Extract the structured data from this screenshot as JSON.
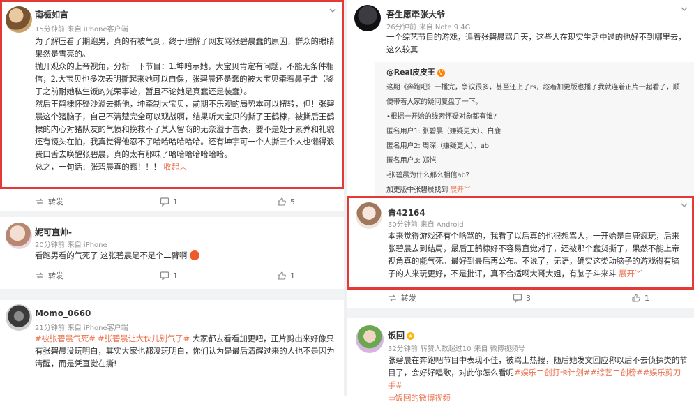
{
  "left": {
    "posts": [
      {
        "name": "南栀如言",
        "time": "15分钟前",
        "source": "来自 iPhone客户端",
        "paragraphs": [
          "为了解压看了期跑男，真的有被气到，终于理解了网友骂张碧晨蠢的原因，群众的眼睛果然是雪亮的。",
          "抛开观众的上帝视角，分析一下节目：1.坤暗示她，大宝贝肯定有问题，不能无条件相信；2.大宝贝也多次表明撕起来她可以自保，张碧晨还是蠢的被大宝贝牵着鼻子走（鉴于之前耐她私生饭的光荣事迹，暂且不论她是真蠢还是装蠢）。",
          "然后王鹤棣怀疑沙溢去撕他，坤牵制大宝贝，前期不乐观的局势本可以扭转，但！张碧晨这个猪脑子，自己不清楚完全可以观战啊，结果听大宝贝的撕了王鹤棣，被撕后王鹤棣的内心对猪队友的气愤和挽救不了某人智商的无奈溢于言表，要不是处于素养和礼貌还有镜头在拍，我真觉得他忍不了哈哈哈哈哈哈。还有坤宇可一个人撕三个人也懒得浪费口舌去唤醒张碧晨，真的太有那味了哈哈哈哈哈哈哈。",
          "总之，一句话：张碧晨真的蠢！！！"
        ],
        "collapse": "收起",
        "actions": {
          "repost": "转发",
          "comment": "1",
          "like": "5"
        }
      },
      {
        "name": "妮可直帅-",
        "time": "20分钟前",
        "source": "来自 iPhone",
        "text": "看跑男看的气死了 这张碧晨是不是个二臂啊",
        "actions": {
          "repost": "转发",
          "comment": "1",
          "like": "1"
        }
      },
      {
        "name": "Momo_0660",
        "time": "21分钟前",
        "source": "来自 iPhone客户端",
        "tags": [
          "#被张碧晨气死#",
          "#张碧晨让大伙儿别气了#"
        ],
        "text": " 大家都去看看加更吧，正片剪出来好像只有张碧晨没玩明白，其实大家也都没玩明白，你们认为是最后清醒过来的人也不是因为清醒，而是凭直觉在撕!"
      }
    ]
  },
  "right": {
    "posts": [
      {
        "name": "吾生愿牵张大爷",
        "time": "26分钟前",
        "source": "来自 Note 9 4G",
        "text": "一个综艺节目的游戏，追着张碧晨骂几天，这些人在现实生活中过的也好不到哪里去，这么较真",
        "quote": {
          "name": "@Real皮皮王",
          "lines": [
            "这期《奔跑吧》一播完，争议很多，甚至还上了rs，趁着加更版也播了我就连着正片一起看了，顺",
            "便带着大家的疑问复盘了一下。",
            "•根据一开始的线索怀疑对象都有谁?",
            "匿名用户1: 张碧晨（嫌疑更大）、白鹿",
            "匿名用户2: 周深（嫌疑更大）、ab",
            "匿名用户3: 郑恺",
            "-张碧晨为什么那么相信ab?",
            "加更版中张碧晨找到"
          ],
          "expand": "展开"
        }
      },
      {
        "name": "青42164",
        "time": "30分钟前",
        "source": "来自 Android",
        "text": "本来觉得游戏还有个啥骂的，我看了以后真的也很想骂人，一开始是白鹿疯玩，后来张碧晨去到结局，最后王鹤棣好不容易直觉对了，还被那个蠢货撕了，果然不能上帝视角真的能气死。最好到最后再公布。不说了，无语，确实这类动脑子的游戏得有脑子的人来玩更好，不是批评，真不合适啊大哥大姐，有脑子斗来斗",
        "expand": "展开",
        "actions": {
          "repost": "转发",
          "comment": "3",
          "like": "1"
        }
      },
      {
        "name": "饭回",
        "time": "32分钟前",
        "source": "转赞人数超过10",
        "source2": "来自 微博视频号",
        "text": "张碧晨在奔跑吧节目中表现不佳，被骂上热搜，随后她发文回应称以后不去侦探类的节目了，会好好唱歌，对此你怎么看呢",
        "tags": [
          "#娱乐二创打卡计划#",
          "#综艺二创榜#",
          "#娱乐剪刀手#"
        ],
        "link": "饭回的微博视频"
      }
    ]
  }
}
